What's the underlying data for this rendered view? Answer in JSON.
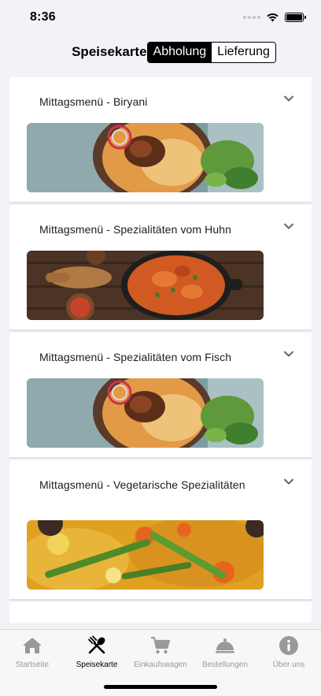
{
  "status": {
    "time": "8:36"
  },
  "nav": {
    "title": "Speisekarte",
    "segments": [
      "Abholung",
      "Lieferung"
    ],
    "active_segment": "Abholung"
  },
  "menu": {
    "categories": [
      {
        "title": "Mittagsmenü - Biryani",
        "image": "biryani-dish-image"
      },
      {
        "title": "Mittagsmenü - Spezialitäten vom Huhn",
        "image": "chicken-curry-image"
      },
      {
        "title": "Mittagsmenü - Spezialitäten vom Fisch",
        "image": "biryani-dish-image"
      },
      {
        "title": "Mittagsmenü - Vegetarische Spezialitäten",
        "image": "vegetable-curry-image"
      }
    ]
  },
  "tabs": [
    {
      "label": "Startseite",
      "icon": "home-icon"
    },
    {
      "label": "Speisekarte",
      "icon": "fork-spoon-icon",
      "active": true
    },
    {
      "label": "Einkaufswagen",
      "icon": "cart-icon"
    },
    {
      "label": "Bestellungen",
      "icon": "cloche-icon"
    },
    {
      "label": "Über uns",
      "icon": "info-icon"
    }
  ],
  "colors": {
    "accent": "#000000",
    "inactive_tab": "#999999",
    "background": "#f2f2f7"
  }
}
